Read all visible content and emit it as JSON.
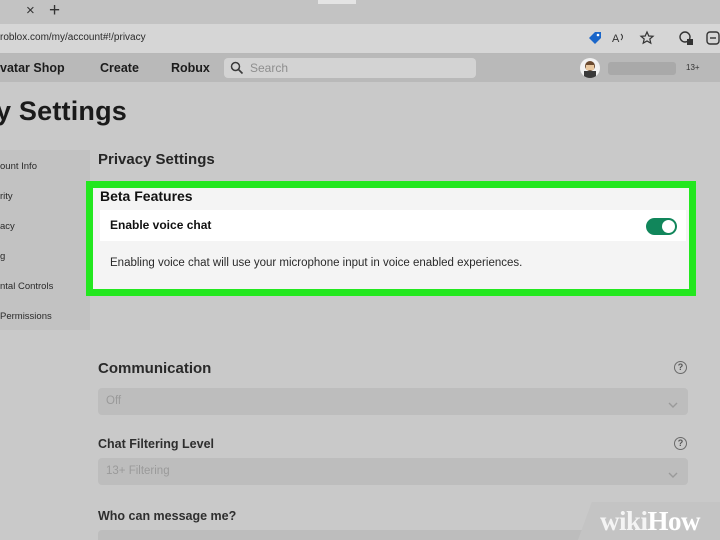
{
  "browser": {
    "url": "roblox.com/my/account#!/privacy",
    "tab_close_glyph": "×",
    "tab_new_glyph": "+",
    "icons": [
      "tag-icon",
      "read-aloud-icon",
      "favorite-add-icon",
      "extension-icon",
      "profile-icon"
    ]
  },
  "nav": {
    "links": [
      "vatar Shop",
      "Create",
      "Robux"
    ],
    "search_placeholder": "Search",
    "age_badge": "13+"
  },
  "page": {
    "title": "y Settings"
  },
  "sidebar": {
    "items": [
      "ount Info",
      "rity",
      "acy",
      "g",
      "ntal Controls",
      "Permissions"
    ]
  },
  "main": {
    "section_title": "Privacy Settings",
    "beta": {
      "title": "Beta Features",
      "voice_label": "Enable voice chat",
      "voice_enabled": true,
      "voice_description": "Enabling voice chat will use your microphone input in voice enabled experiences."
    },
    "communication": {
      "label": "Communication",
      "value": "Off"
    },
    "chat_filter": {
      "label": "Chat Filtering Level",
      "value": "13+ Filtering"
    },
    "message": {
      "label": "Who can message me?"
    },
    "help_glyph": "?"
  },
  "colors": {
    "highlight_border": "#23e71f",
    "toggle_on": "#11865b"
  },
  "watermark": {
    "wiki": "wiki",
    "how": "How"
  }
}
